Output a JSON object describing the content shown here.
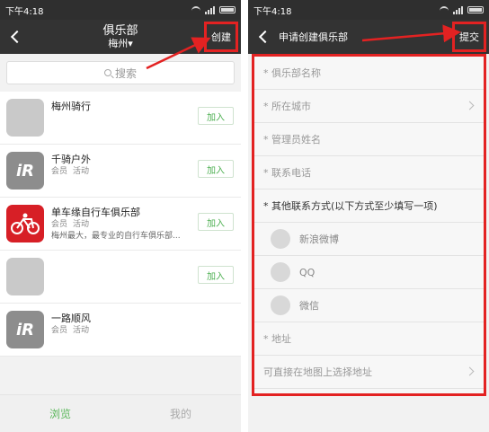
{
  "left": {
    "status_time": "下午4:18",
    "nav": {
      "title": "俱乐部",
      "subtitle": "梅州▾",
      "create": "创建"
    },
    "search_placeholder": "搜索",
    "clubs": [
      {
        "name": "梅州骑行",
        "tags": [
          "",
          ""
        ],
        "desc": "",
        "join": "加入",
        "avatar": ""
      },
      {
        "name": "千骑户外",
        "tags": [
          "会员",
          "活动"
        ],
        "desc": "",
        "join": "加入",
        "avatar": "iR"
      },
      {
        "name": "单车缘自行车俱乐部",
        "tags": [
          "会员",
          "活动"
        ],
        "desc": "梅州最大，最专业的自行车俱乐部...",
        "join": "加入",
        "avatar": ""
      },
      {
        "name": "",
        "tags": [
          "",
          ""
        ],
        "desc": "",
        "join": "加入",
        "avatar": ""
      },
      {
        "name": "一路顺风",
        "tags": [
          "会员",
          "活动"
        ],
        "desc": "",
        "join": "",
        "avatar": "iR"
      }
    ],
    "tabs": [
      {
        "label": "浏览"
      },
      {
        "label": "我的"
      }
    ]
  },
  "right": {
    "status_time": "下午4:18",
    "nav": {
      "title": "申请创建俱乐部",
      "submit": "提交"
    },
    "fields": {
      "club_name": "* 俱乐部名称",
      "city": "* 所在城市",
      "admin_name": "* 管理员姓名",
      "phone": "* 联系电话",
      "other_contacts": "* 其他联系方式(以下方式至少填写一项)",
      "weibo": "新浪微博",
      "qq": "QQ",
      "wechat": "微信",
      "address": "* 地址",
      "map_select": "可直接在地图上选择地址"
    }
  },
  "colors": {
    "annotation": "#e32222",
    "accent": "#5cb85c",
    "navbar": "#333333"
  }
}
